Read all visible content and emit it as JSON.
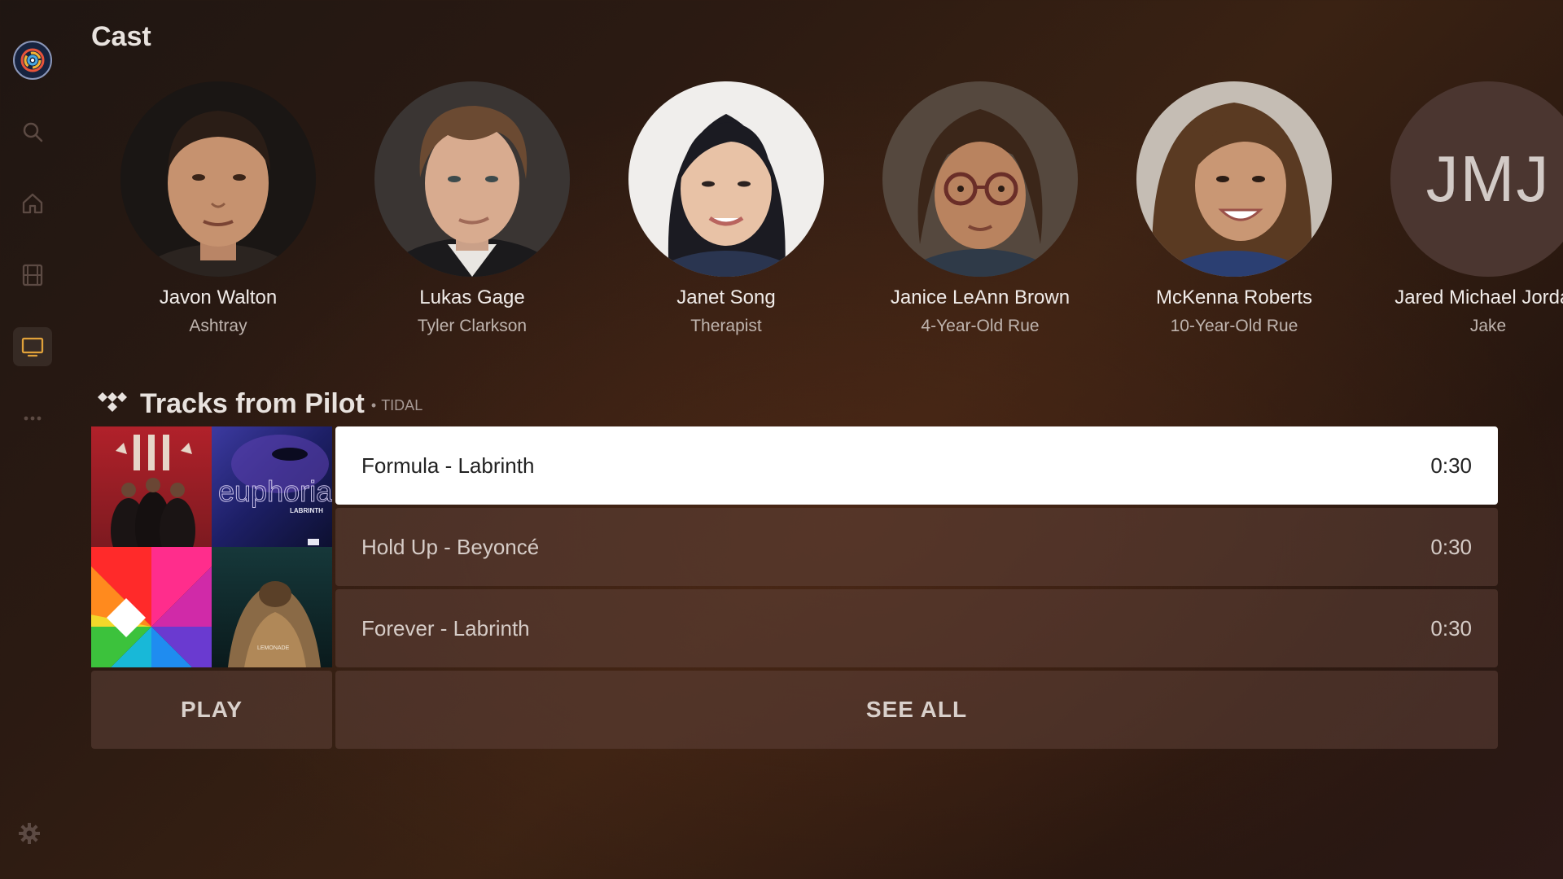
{
  "sidebar": {
    "logo_icon": "app-logo-icon",
    "items": [
      {
        "name": "search",
        "icon": "search-icon"
      },
      {
        "name": "home",
        "icon": "home-icon"
      },
      {
        "name": "movies",
        "icon": "film-icon"
      },
      {
        "name": "tv",
        "icon": "tv-icon",
        "active": true
      },
      {
        "name": "more",
        "icon": "more-icon"
      },
      {
        "name": "settings",
        "icon": "gear-icon"
      }
    ],
    "active_color": "#e0a13a"
  },
  "cast": {
    "title": "Cast",
    "members": [
      {
        "name": "Javon Walton",
        "role": "Ashtray"
      },
      {
        "name": "Lukas Gage",
        "role": "Tyler Clarkson"
      },
      {
        "name": "Janet Song",
        "role": "Therapist"
      },
      {
        "name": "Janice LeAnn Brown",
        "role": "4-Year-Old Rue"
      },
      {
        "name": "McKenna Roberts",
        "role": "10-Year-Old Rue"
      },
      {
        "name": "Jared Michael Jordan",
        "role": "Jake",
        "initials": "JMJ"
      }
    ]
  },
  "tracks": {
    "title": "Tracks from Pilot",
    "separator": "•",
    "source": "TIDAL",
    "items": [
      {
        "title": "Formula - Labrinth",
        "duration": "0:30",
        "selected": true
      },
      {
        "title": "Hold Up - Beyoncé",
        "duration": "0:30"
      },
      {
        "title": "Forever - Labrinth",
        "duration": "0:30"
      }
    ],
    "album_texts": {
      "euphoria": "euphoria",
      "labrinth": "LABRINTH",
      "lemonade": "LEMONADE"
    },
    "play_label": "PLAY",
    "see_all_label": "SEE ALL"
  }
}
